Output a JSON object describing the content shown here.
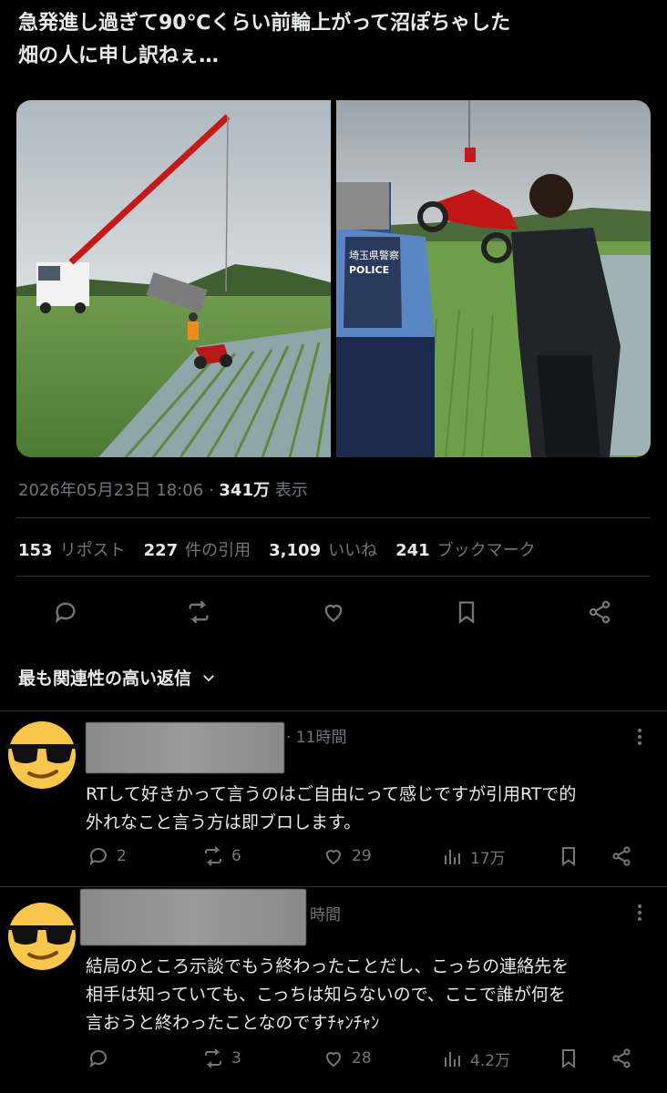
{
  "tweet": {
    "text_line1": "急発進し過ぎて90℃くらい前輪上がって沼ぽちゃした",
    "text_line2": "畑の人に申し訳ねぇ…",
    "date": "2026年05月23日 18:06",
    "sep": " · ",
    "views": "341万",
    "views_label": " 表示",
    "stats": [
      {
        "count": "153",
        "label": "リポスト"
      },
      {
        "count": "227",
        "label": "件の引用"
      },
      {
        "count": "3,109",
        "label": "いいね"
      },
      {
        "count": "241",
        "label": "ブックマーク"
      }
    ],
    "photo_right_badge": "埼玉県警察",
    "photo_right_vest": "POLICE"
  },
  "replies_header": "最も関連性の高い返信",
  "replies": [
    {
      "time": "· 11時間",
      "text_line1": "RTして好きかって言うのはご自由にって感じですが引用RTで的",
      "text_line2": "外れなこと言う方は即ブロします。",
      "reply_count": "2",
      "repost_count": "6",
      "like_count": "29",
      "views": "17万"
    },
    {
      "time": "時間",
      "text_line1": "結局のところ示談でもう終わったことだし、こっちの連絡先を",
      "text_line2": "相手は知っていても、こっちは知らないので、ここで誰が何を",
      "text_line3": "言おうと終わったことなのですﾁｬﾝﾁｬﾝ",
      "reply_count": "",
      "repost_count": "3",
      "like_count": "28",
      "views": "4.2万"
    }
  ],
  "colors": {
    "background": "#000000",
    "text": "#e7e9ea",
    "muted": "#71767b",
    "divider": "#2f3336"
  }
}
